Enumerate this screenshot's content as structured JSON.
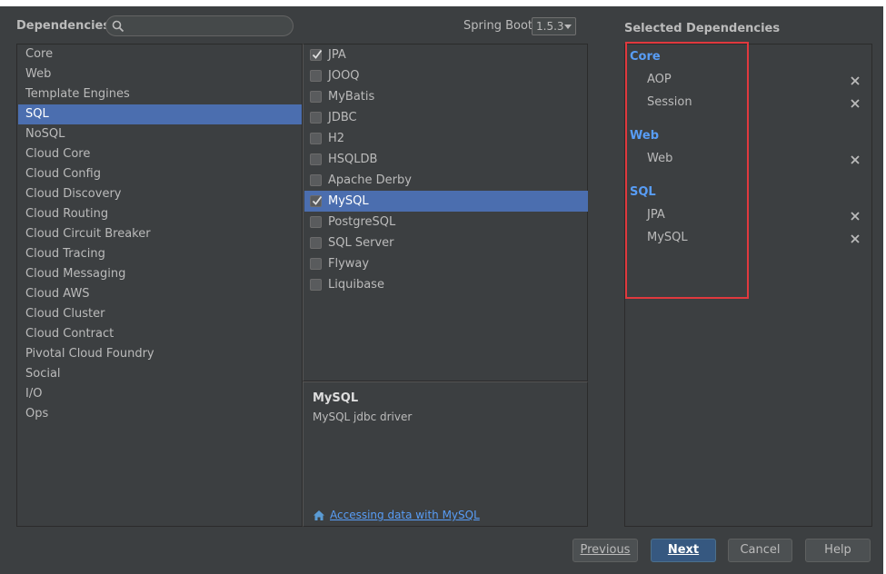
{
  "header": {
    "dependencies_label": "Dependencies",
    "spring_boot_label": "Spring Boot",
    "spring_boot_version": "1.5.3"
  },
  "categories": [
    {
      "label": "Core"
    },
    {
      "label": "Web"
    },
    {
      "label": "Template Engines"
    },
    {
      "label": "SQL",
      "selected": true
    },
    {
      "label": "NoSQL"
    },
    {
      "label": "Cloud Core"
    },
    {
      "label": "Cloud Config"
    },
    {
      "label": "Cloud Discovery"
    },
    {
      "label": "Cloud Routing"
    },
    {
      "label": "Cloud Circuit Breaker"
    },
    {
      "label": "Cloud Tracing"
    },
    {
      "label": "Cloud Messaging"
    },
    {
      "label": "Cloud AWS"
    },
    {
      "label": "Cloud Cluster"
    },
    {
      "label": "Cloud Contract"
    },
    {
      "label": "Pivotal Cloud Foundry"
    },
    {
      "label": "Social"
    },
    {
      "label": "I/O"
    },
    {
      "label": "Ops"
    }
  ],
  "dependencies": [
    {
      "label": "JPA",
      "checked": true
    },
    {
      "label": "JOOQ",
      "checked": false
    },
    {
      "label": "MyBatis",
      "checked": false
    },
    {
      "label": "JDBC",
      "checked": false
    },
    {
      "label": "H2",
      "checked": false
    },
    {
      "label": "HSQLDB",
      "checked": false
    },
    {
      "label": "Apache Derby",
      "checked": false
    },
    {
      "label": "MySQL",
      "checked": true,
      "selected": true
    },
    {
      "label": "PostgreSQL",
      "checked": false
    },
    {
      "label": "SQL Server",
      "checked": false
    },
    {
      "label": "Flyway",
      "checked": false
    },
    {
      "label": "Liquibase",
      "checked": false
    }
  ],
  "description": {
    "title": "MySQL",
    "text": "MySQL jdbc driver",
    "link": "Accessing data with MySQL"
  },
  "selected": {
    "title": "Selected Dependencies",
    "groups": [
      {
        "name": "Core",
        "items": [
          "AOP",
          "Session"
        ]
      },
      {
        "name": "Web",
        "items": [
          "Web"
        ]
      },
      {
        "name": "SQL",
        "items": [
          "JPA",
          "MySQL"
        ]
      }
    ]
  },
  "buttons": {
    "previous": "Previous",
    "next": "Next",
    "cancel": "Cancel",
    "help": "Help"
  },
  "colors": {
    "selection": "#4b6eaf",
    "group_header": "#589df6",
    "highlight_box": "#e0393e"
  }
}
